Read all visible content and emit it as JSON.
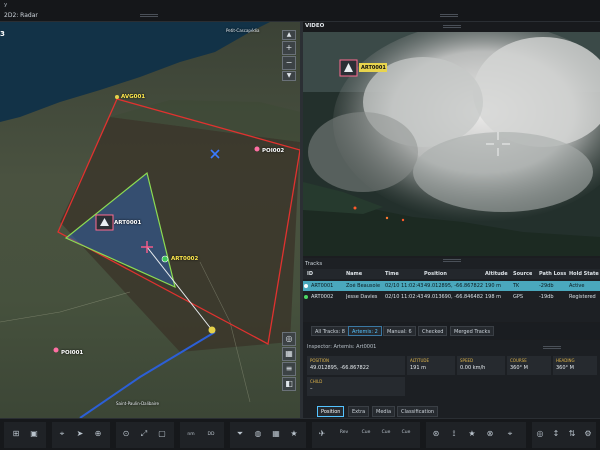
{
  "topbar": {
    "window_label": "y",
    "view_title": "2D2: Radar"
  },
  "map": {
    "corner_label": "3",
    "controls": {
      "zoom_in": "+",
      "zoom_out": "−",
      "up": "▲",
      "down": "▼"
    },
    "markers": [
      {
        "name": "AVG001",
        "color": "yellow"
      },
      {
        "name": "POI002",
        "color": "white"
      },
      {
        "name": "ART0001",
        "color": "white"
      },
      {
        "name": "ART0002",
        "color": "yellow"
      },
      {
        "name": "POI001",
        "color": "white"
      }
    ],
    "places": [
      "Petit-Cascapédia",
      "Saint-Paulin-Dalibaire"
    ],
    "colors": {
      "zone_outline": "#e0322f",
      "area_outline": "#8cdc52",
      "area_fill": "#2f5fa8"
    }
  },
  "video": {
    "title": "VIDEO",
    "target_label": "ART0001"
  },
  "tracks": {
    "title": "Tracks",
    "columns": [
      "ID",
      "Name",
      "Time",
      "Position",
      "Altitude",
      "Source",
      "Path Loss",
      "Hold State"
    ],
    "rows": [
      {
        "id": "ART0001",
        "name": "Zoé Beausoie",
        "time": "02/10 11:02:43",
        "position": "49.012895, -66.867822",
        "altitude": "190 m",
        "source": "TK",
        "path_loss": "-29db",
        "hold_state": "Active",
        "color": "#ffffff",
        "selected": true
      },
      {
        "id": "ART0002",
        "name": "Jesse Davies",
        "time": "02/10 11:02:43",
        "position": "49.013690, -66.846482",
        "altitude": "198 m",
        "source": "GPS",
        "path_loss": "-19db",
        "hold_state": "Registered",
        "color": "#4cd964",
        "selected": false
      }
    ]
  },
  "filters": [
    {
      "label": "All Tracks: 8",
      "active": false
    },
    {
      "label": "Artemis: 2",
      "active": true
    },
    {
      "label": "Manual: 6",
      "active": false
    },
    {
      "label": "Checked",
      "active": false
    },
    {
      "label": "Merged Tracks",
      "active": false
    }
  ],
  "inspector": {
    "header": "Inspector: Artemis: Art0001",
    "fields": {
      "position": {
        "label": "POSITION",
        "value": "49.012895, -66.867822"
      },
      "altitude": {
        "label": "ALTITUDE",
        "value": "191 m"
      },
      "speed": {
        "label": "SPEED",
        "value": "0.00 km/h"
      },
      "course": {
        "label": "COURSE",
        "value": "360° M"
      },
      "heading": {
        "label": "HEADING",
        "value": "360° M"
      },
      "child": {
        "label": "CHILD",
        "value": "–"
      }
    },
    "tabs": [
      "Position",
      "Extra",
      "Media",
      "Classification"
    ]
  },
  "toolbar": {
    "nm": "nm",
    "dd": "DD",
    "cue1": "Cue",
    "cue2": "Cue",
    "cue3": "Cue",
    "rev": "Rev"
  }
}
